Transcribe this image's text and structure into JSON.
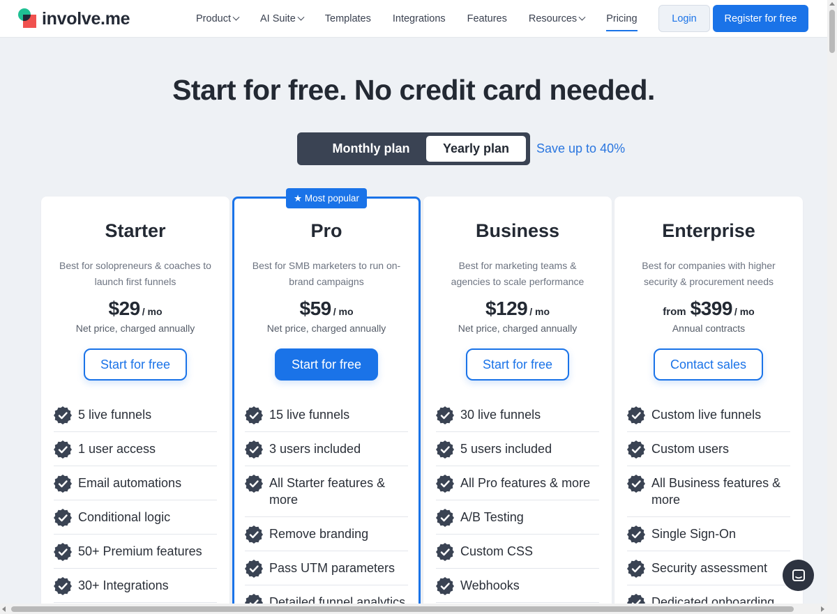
{
  "header": {
    "logo_text": "involve.me",
    "nav": [
      {
        "label": "Product",
        "dropdown": true
      },
      {
        "label": "AI Suite",
        "dropdown": true
      },
      {
        "label": "Templates",
        "dropdown": false
      },
      {
        "label": "Integrations",
        "dropdown": false
      },
      {
        "label": "Features",
        "dropdown": false
      },
      {
        "label": "Resources",
        "dropdown": true
      },
      {
        "label": "Pricing",
        "dropdown": false,
        "active": true
      }
    ],
    "login_label": "Login",
    "register_label": "Register for free"
  },
  "hero": {
    "title": "Start for free. No credit card needed."
  },
  "billing_toggle": {
    "monthly_label": "Monthly plan",
    "yearly_label": "Yearly plan",
    "selected": "Yearly plan",
    "save_text": "Save up to 40%"
  },
  "badge": "★ Most popular",
  "plans": [
    {
      "name": "Starter",
      "description": "Best for solopreneurs & coaches to launch first funnels",
      "from": "",
      "price": "$29",
      "unit": "/ mo",
      "note": "Net price, charged annually",
      "cta": "Start for free",
      "features": [
        "5 live funnels",
        "1 user access",
        "Email automations",
        "Conditional logic",
        "50+ Premium features",
        "30+ Integrations"
      ]
    },
    {
      "name": "Pro",
      "description": "Best for SMB marketers to run on-brand campaigns",
      "from": "",
      "price": "$59",
      "unit": "/ mo",
      "note": "Net price, charged annually",
      "cta": "Start for free",
      "features": [
        "15 live funnels",
        "3 users included",
        "All Starter features & more",
        "Remove branding",
        "Pass UTM parameters",
        "Detailed funnel analytics"
      ]
    },
    {
      "name": "Business",
      "description": "Best for marketing teams & agencies to scale performance",
      "from": "",
      "price": "$129",
      "unit": "/ mo",
      "note": "Net price, charged annually",
      "cta": "Start for free",
      "features": [
        "30 live funnels",
        "5 users included",
        "All Pro features & more",
        "A/B Testing",
        "Custom CSS",
        "Webhooks"
      ]
    },
    {
      "name": "Enterprise",
      "description": "Best for companies with higher security & procurement needs",
      "from": "from",
      "price": "$399",
      "unit": "/ mo",
      "note": "Annual contracts",
      "cta": "Contact sales",
      "features": [
        "Custom live funnels",
        "Custom users",
        "All Business features & more",
        "Single Sign-On",
        "Security assessment",
        "Dedicated onboarding"
      ]
    }
  ],
  "colors": {
    "accent": "#1a73e8",
    "check_badge": "#3a4353",
    "toggle_bg": "#3a4353",
    "page_bg": "#eef1f5"
  },
  "icons": {
    "feature_check": "check-badge-icon",
    "chat": "chat-bubble-icon",
    "dropdown": "chevron-down-icon"
  }
}
